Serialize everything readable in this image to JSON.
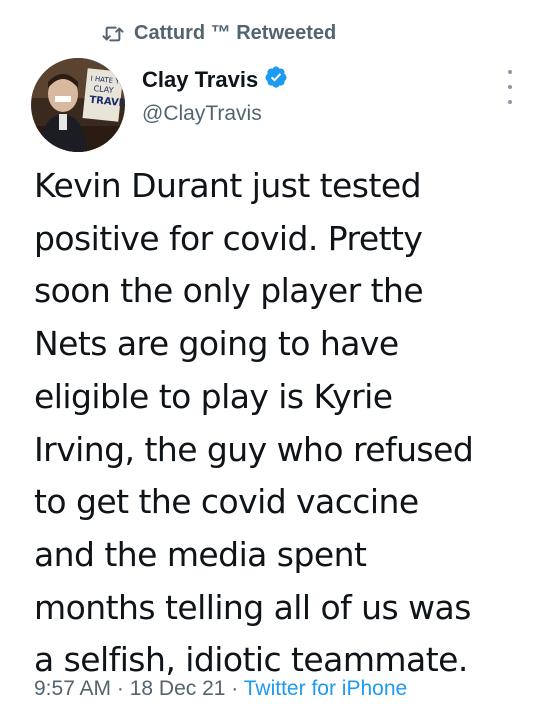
{
  "retweet": {
    "label": "Catturd ™ Retweeted",
    "icon": "retweet-icon"
  },
  "author": {
    "display_name": "Clay Travis",
    "handle": "@ClayTravis",
    "verified_icon": "verified-badge-icon",
    "avatar_sign_text": "I HATE YOU CLAY TRAVIS"
  },
  "tweet": {
    "lines": [
      "Kevin Durant just tested",
      "positive for covid. Pretty",
      "soon the only player the",
      "Nets are going to have",
      "eligible to play is Kyrie",
      "Irving, the guy who refused",
      "to get the covid vaccine",
      "and the media spent",
      "months telling all of us was",
      "a selfish, idiotic teammate."
    ]
  },
  "meta": {
    "time": "9:57 AM",
    "separator": " · ",
    "date": "18 Dec 21",
    "source": "Twitter for iPhone"
  },
  "colors": {
    "text": "#0f1419",
    "secondary": "#536471",
    "accent": "#1d9bf0"
  },
  "more_icon": "more-vertical-icon"
}
